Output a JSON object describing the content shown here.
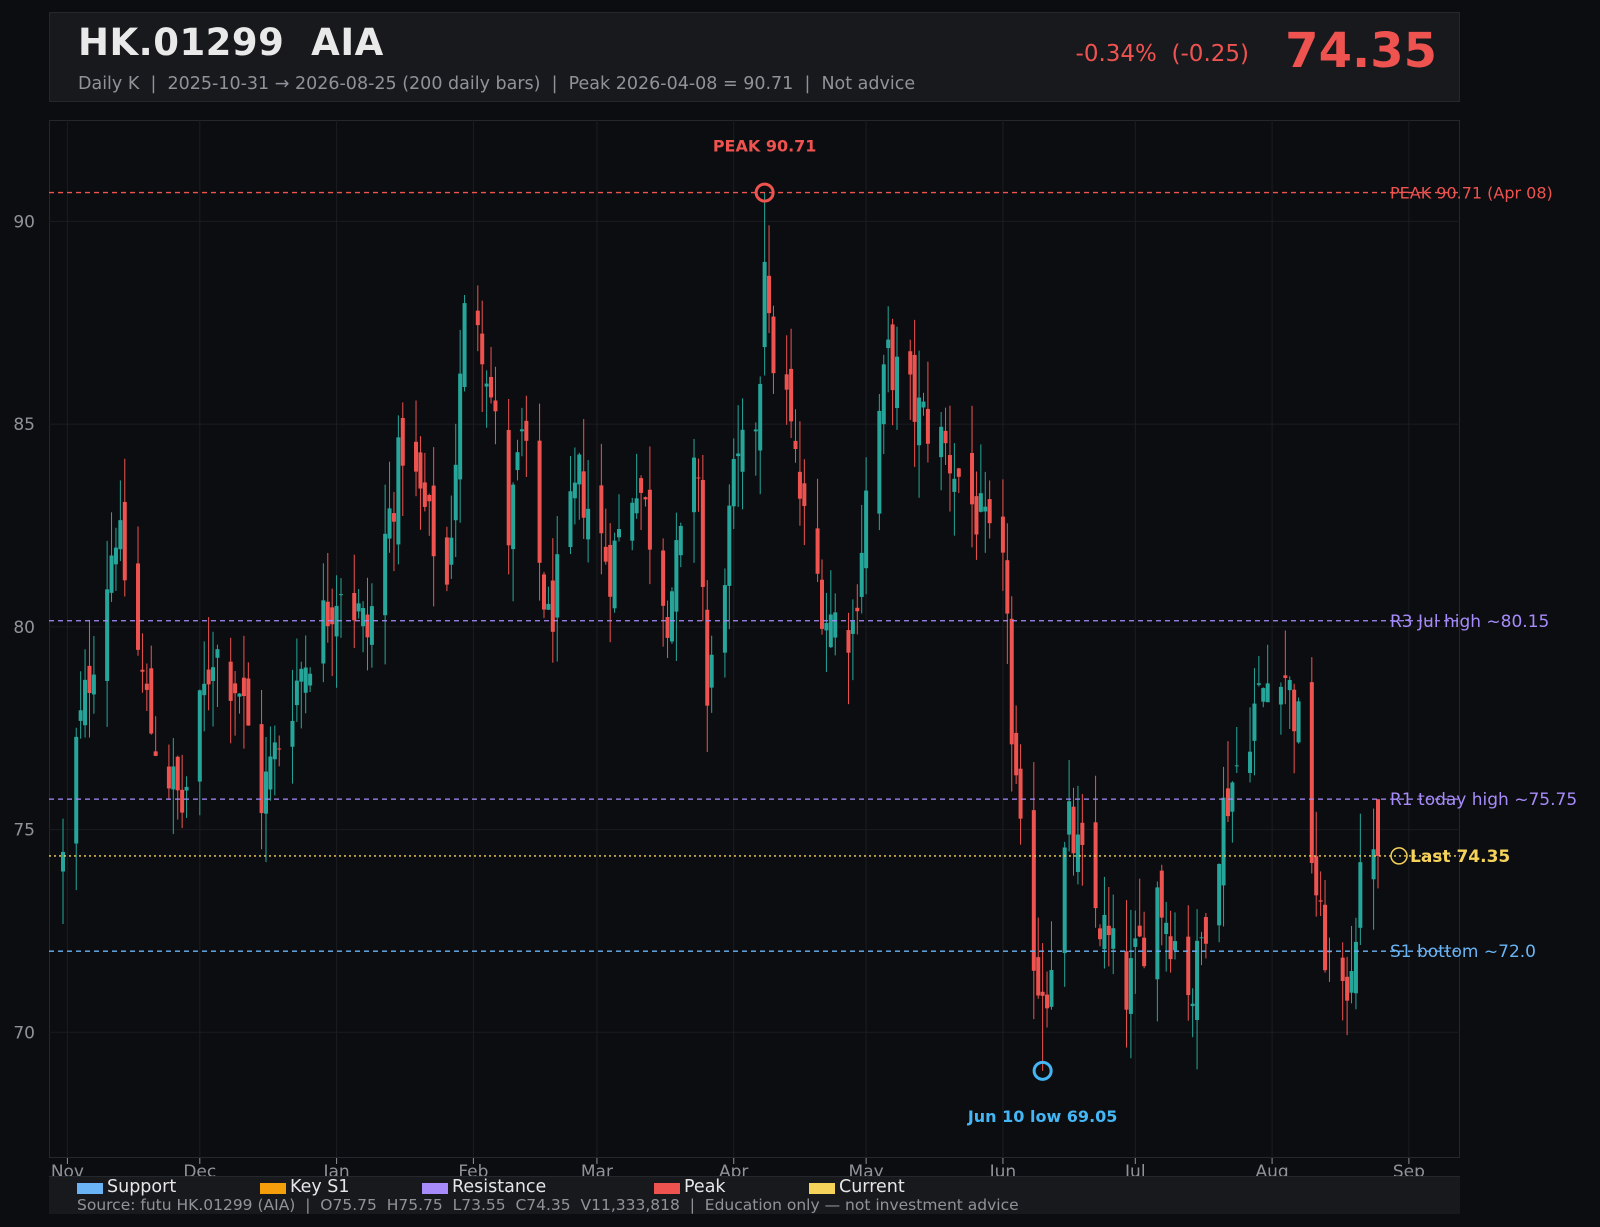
{
  "header": {
    "title": "HK.01299  AIA",
    "subtitle": "Daily K  |  2025-10-31 → 2026-08-25 (200 daily bars)  |  Peak 2026-04-08 = 90.71  |  Not advice",
    "change": "-0.34%  (-0.25)",
    "last_price": "74.35"
  },
  "colors": {
    "background": "#0c0d10",
    "panel": "#17191d",
    "up": "#26a69a",
    "down": "#ef5350",
    "support": "#6ab4f5",
    "key_s1": "#f59e0b",
    "resistance": "#a78bfa",
    "peak": "#ef5350",
    "current": "#f5d35a"
  },
  "legend": [
    {
      "label": "Support",
      "color": "#6ab4f5"
    },
    {
      "label": "Key S1",
      "color": "#f59e0b"
    },
    {
      "label": "Resistance",
      "color": "#a78bfa"
    },
    {
      "label": "Peak",
      "color": "#ef5350"
    },
    {
      "label": "Current",
      "color": "#f5d35a"
    }
  ],
  "footer": {
    "source": "Source: futu HK.01299 (AIA)  |  O75.75  H75.75  L73.55  C74.35  V11,333,818  |  Education only — not investment advice"
  },
  "chart_data": {
    "type": "candlestick",
    "x_range": [
      "2025-10-31",
      "2026-08-25"
    ],
    "bar_count": 200,
    "ylim": [
      66.9,
      92.5
    ],
    "yticks": [
      70,
      75,
      80,
      85,
      90
    ],
    "xticks": [
      {
        "label": "Nov",
        "date": "2025-11-01"
      },
      {
        "label": "Dec",
        "date": "2025-12-01"
      },
      {
        "label": "Jan",
        "date": "2026-01-01"
      },
      {
        "label": "Feb",
        "date": "2026-02-01"
      },
      {
        "label": "Mar",
        "date": "2026-03-01"
      },
      {
        "label": "Apr",
        "date": "2026-04-01"
      },
      {
        "label": "May",
        "date": "2026-05-01"
      },
      {
        "label": "Jun",
        "date": "2026-06-01"
      },
      {
        "label": "Jul",
        "date": "2026-07-01"
      },
      {
        "label": "Aug",
        "date": "2026-08-01"
      },
      {
        "label": "Sep",
        "date": "2026-09-01"
      }
    ],
    "grid": true,
    "levels": [
      {
        "label": "PEAK 90.71 (Apr 08)",
        "value": 90.71,
        "kind": "peak",
        "style": "dashed"
      },
      {
        "label": "R3 Jul high ~80.15",
        "value": 80.15,
        "kind": "resistance",
        "style": "dashed"
      },
      {
        "label": "R1 today high ~75.75",
        "value": 75.75,
        "kind": "resistance",
        "style": "dashed"
      },
      {
        "label": "Last 74.35",
        "value": 74.35,
        "kind": "current",
        "style": "dotted"
      },
      {
        "label": "S1 bottom ~72.0",
        "value": 72.0,
        "kind": "support",
        "style": "dashed"
      }
    ],
    "annotations": [
      {
        "label": "PEAK 90.71",
        "date": "2026-04-08",
        "value": 90.71,
        "kind": "peak"
      },
      {
        "label": "Jun 10 low 69.05",
        "date": "2026-06-10",
        "value": 69.05,
        "kind": "support"
      }
    ],
    "anchors": [
      {
        "date": "2025-10-31",
        "close": 74.2
      },
      {
        "date": "2025-11-03",
        "close": 77.0
      },
      {
        "date": "2025-11-12",
        "close": 82.5
      },
      {
        "date": "2025-11-20",
        "close": 77.5
      },
      {
        "date": "2025-11-27",
        "close": 75.5
      },
      {
        "date": "2025-12-04",
        "close": 79.5
      },
      {
        "date": "2025-12-10",
        "close": 78.5
      },
      {
        "date": "2025-12-15",
        "close": 75.8
      },
      {
        "date": "2025-12-24",
        "close": 79.0
      },
      {
        "date": "2026-01-02",
        "close": 81.2
      },
      {
        "date": "2026-01-08",
        "close": 79.8
      },
      {
        "date": "2026-01-16",
        "close": 84.5
      },
      {
        "date": "2026-01-21",
        "close": 82.8
      },
      {
        "date": "2026-01-26",
        "close": 81.0
      },
      {
        "date": "2026-01-31",
        "close": 89.2
      },
      {
        "date": "2026-02-04",
        "close": 86.5
      },
      {
        "date": "2026-02-09",
        "close": 82.3
      },
      {
        "date": "2026-02-12",
        "close": 84.6
      },
      {
        "date": "2026-02-18",
        "close": 80.0
      },
      {
        "date": "2026-02-25",
        "close": 83.6
      },
      {
        "date": "2026-03-04",
        "close": 81.5
      },
      {
        "date": "2026-03-10",
        "close": 83.8
      },
      {
        "date": "2026-03-17",
        "close": 80.5
      },
      {
        "date": "2026-03-24",
        "close": 84.0
      },
      {
        "date": "2026-03-26",
        "close": 78.0
      },
      {
        "date": "2026-04-01",
        "close": 83.4
      },
      {
        "date": "2026-04-06",
        "close": 85.2
      },
      {
        "date": "2026-04-08",
        "close": 87.5
      },
      {
        "date": "2026-04-13",
        "close": 85.5
      },
      {
        "date": "2026-04-17",
        "close": 82.5
      },
      {
        "date": "2026-04-22",
        "close": 80.3
      },
      {
        "date": "2026-04-28",
        "close": 80.0
      },
      {
        "date": "2026-05-01",
        "close": 83.2
      },
      {
        "date": "2026-05-06",
        "close": 86.6
      },
      {
        "date": "2026-05-12",
        "close": 85.4
      },
      {
        "date": "2026-05-18",
        "close": 84.6
      },
      {
        "date": "2026-05-26",
        "close": 82.8
      },
      {
        "date": "2026-06-02",
        "close": 80.8
      },
      {
        "date": "2026-06-03",
        "close": 76.9
      },
      {
        "date": "2026-06-05",
        "close": 74.5
      },
      {
        "date": "2026-06-10",
        "close": 70.5
      },
      {
        "date": "2026-06-16",
        "close": 75.0
      },
      {
        "date": "2026-06-22",
        "close": 73.0
      },
      {
        "date": "2026-06-29",
        "close": 71.0
      },
      {
        "date": "2026-07-06",
        "close": 73.5
      },
      {
        "date": "2026-07-14",
        "close": 71.0
      },
      {
        "date": "2026-07-21",
        "close": 75.5
      },
      {
        "date": "2026-07-28",
        "close": 78.0
      },
      {
        "date": "2026-08-03",
        "close": 79.3
      },
      {
        "date": "2026-08-07",
        "close": 77.5
      },
      {
        "date": "2026-08-12",
        "close": 72.5
      },
      {
        "date": "2026-08-17",
        "close": 70.5
      },
      {
        "date": "2026-08-21",
        "close": 73.5
      },
      {
        "date": "2026-08-24",
        "close": 75.0
      },
      {
        "date": "2026-08-25",
        "close": 74.35
      }
    ],
    "last_bar": {
      "open": 75.75,
      "high": 75.75,
      "low": 73.55,
      "close": 74.35
    }
  }
}
